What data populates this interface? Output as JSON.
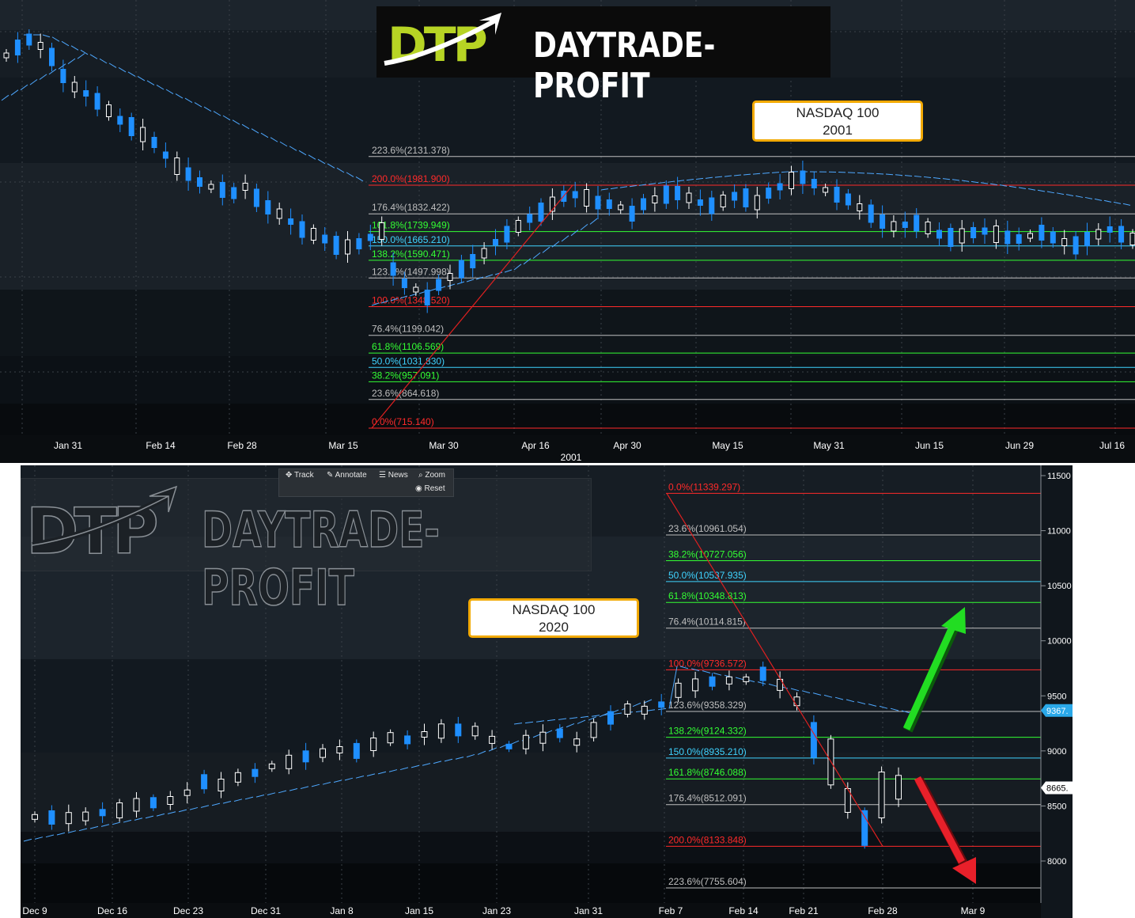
{
  "panels": [
    {
      "id": "top",
      "title_lines": [
        "NASDAQ 100",
        "2001"
      ],
      "year_label": "2001",
      "x_ticks": [
        "Jan 31",
        "Feb 14",
        "Feb 28",
        "Mar 15",
        "Mar 30",
        "Apr 16",
        "Apr 30",
        "May 15",
        "May 31",
        "Jun 15",
        "Jun 29",
        "Jul 16"
      ],
      "fib_levels": [
        {
          "label": "223.6%(2131.378)",
          "value": 2131.378,
          "color": "#bfbfbf"
        },
        {
          "label": "200.0%(1981.900)",
          "value": 1981.9,
          "color": "#ff2a2a"
        },
        {
          "label": "176.4%(1832.422)",
          "value": 1832.422,
          "color": "#bfbfbf"
        },
        {
          "label": "161.8%(1739.949)",
          "value": 1739.949,
          "color": "#33ff33"
        },
        {
          "label": "150.0%(1665.210)",
          "value": 1665.21,
          "color": "#3fd3ff"
        },
        {
          "label": "138.2%(1590.471)",
          "value": 1590.471,
          "color": "#33ff33"
        },
        {
          "label": "123.6%(1497.998)",
          "value": 1497.998,
          "color": "#bfbfbf"
        },
        {
          "label": "100.0%(1348.520)",
          "value": 1348.52,
          "color": "#ff2a2a"
        },
        {
          "label": "76.4%(1199.042)",
          "value": 1199.042,
          "color": "#bfbfbf"
        },
        {
          "label": "61.8%(1106.569)",
          "value": 1106.569,
          "color": "#33ff33"
        },
        {
          "label": "50.0%(1031.830)",
          "value": 1031.83,
          "color": "#3fd3ff"
        },
        {
          "label": "38.2%(957.091)",
          "value": 957.091,
          "color": "#33ff33"
        },
        {
          "label": "23.6%(864.618)",
          "value": 864.618,
          "color": "#bfbfbf"
        },
        {
          "label": "0.0%(715.140)",
          "value": 715.14,
          "color": "#ff2a2a"
        }
      ]
    },
    {
      "id": "bottom",
      "title_lines": [
        "NASDAQ 100",
        "2020"
      ],
      "x_ticks": [
        "Dec 9",
        "Dec 16",
        "Dec 23",
        "Dec 31",
        "Jan 8",
        "Jan 15",
        "Jan 23",
        "Jan 31",
        "Feb 7",
        "Feb 14",
        "Feb 21",
        "Feb 28",
        "Mar 9"
      ],
      "y_ticks": [
        "11500",
        "11000",
        "10500",
        "10000",
        "9500",
        "9000",
        "8500",
        "8000"
      ],
      "price_tags": [
        "9367.",
        "8665."
      ],
      "toolbar": {
        "track": "Track",
        "annotate": "Annotate",
        "news": "News",
        "zoom": "Zoom",
        "reset": "Reset"
      },
      "fib_levels": [
        {
          "label": "0.0%(11339.297)",
          "value": 11339.297,
          "color": "#ff2a2a"
        },
        {
          "label": "23.6%(10961.054)",
          "value": 10961.054,
          "color": "#bfbfbf"
        },
        {
          "label": "38.2%(10727.056)",
          "value": 10727.056,
          "color": "#33ff33"
        },
        {
          "label": "50.0%(10537.935)",
          "value": 10537.935,
          "color": "#3fd3ff"
        },
        {
          "label": "61.8%(10348.813)",
          "value": 10348.813,
          "color": "#33ff33"
        },
        {
          "label": "76.4%(10114.815)",
          "value": 10114.815,
          "color": "#bfbfbf"
        },
        {
          "label": "100.0%(9736.572)",
          "value": 9736.572,
          "color": "#ff2a2a"
        },
        {
          "label": "123.6%(9358.329)",
          "value": 9358.329,
          "color": "#bfbfbf"
        },
        {
          "label": "138.2%(9124.332)",
          "value": 9124.332,
          "color": "#33ff33"
        },
        {
          "label": "150.0%(8935.210)",
          "value": 8935.21,
          "color": "#3fd3ff"
        },
        {
          "label": "161.8%(8746.088)",
          "value": 8746.088,
          "color": "#33ff33"
        },
        {
          "label": "176.4%(8512.091)",
          "value": 8512.091,
          "color": "#bfbfbf"
        },
        {
          "label": "200.0%(8133.848)",
          "value": 8133.848,
          "color": "#ff2a2a"
        },
        {
          "label": "223.6%(7755.604)",
          "value": 7755.604,
          "color": "#bfbfbf"
        }
      ]
    }
  ],
  "brand": {
    "mark": "DTP",
    "name": "DAYTRADE-PROFIT"
  },
  "colors": {
    "bg": "#0d1217",
    "bull": "#ffffff",
    "bear": "#1f8fff",
    "trend": "#e02020",
    "up_arrow": "#22dd22",
    "down_arrow": "#e8202a",
    "title_border": "#f2a900"
  },
  "chart_data": [
    {
      "type": "candlestick",
      "title": "NASDAQ 100 2001",
      "period": "2001",
      "x": [
        "Jan 31",
        "Feb 14",
        "Feb 28",
        "Mar 15",
        "Mar 30",
        "Apr 16",
        "Apr 30",
        "May 15",
        "May 31",
        "Jun 15",
        "Jun 29",
        "Jul 16"
      ],
      "trend_from": 715.14,
      "trend_to": 1981.9,
      "fibonacci": [
        2131.378,
        1981.9,
        1832.422,
        1739.949,
        1665.21,
        1590.471,
        1497.998,
        1348.52,
        1199.042,
        1106.569,
        1031.83,
        957.091,
        864.618,
        715.14
      ]
    },
    {
      "type": "candlestick",
      "title": "NASDAQ 100 2020",
      "x": [
        "Dec 9",
        "Dec 16",
        "Dec 23",
        "Dec 31",
        "Jan 8",
        "Jan 15",
        "Jan 23",
        "Jan 31",
        "Feb 7",
        "Feb 14",
        "Feb 21",
        "Feb 28",
        "Mar 9"
      ],
      "ylim": [
        7750,
        11550
      ],
      "last_price": 8665,
      "trend_from": 11339.297,
      "trend_to": 8133.848,
      "fibonacci": [
        11339.297,
        10961.054,
        10727.056,
        10537.935,
        10348.813,
        10114.815,
        9736.572,
        9358.329,
        9124.332,
        8935.21,
        8746.088,
        8512.091,
        8133.848,
        7755.604
      ]
    }
  ]
}
